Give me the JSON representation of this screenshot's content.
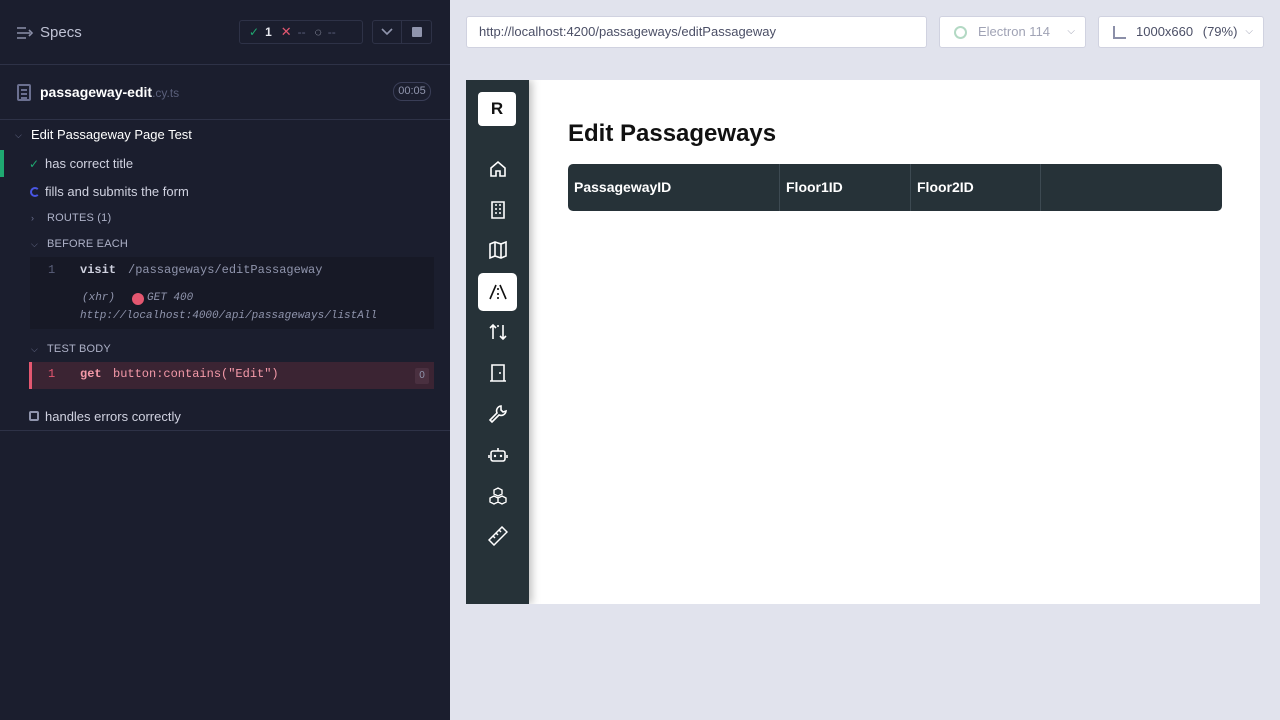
{
  "reporter": {
    "specs_label": "Specs",
    "stats": {
      "passed": "1",
      "failed": "--",
      "pending": "--"
    },
    "file": {
      "name": "passageway-edit",
      "ext": ".cy.ts",
      "duration": "00:05"
    },
    "suite_title": "Edit Passageway Page Test",
    "tests": [
      {
        "label": "has correct title",
        "state": "passed"
      },
      {
        "label": "fills and submits the form",
        "state": "running"
      },
      {
        "label": "handles errors correctly",
        "state": "pending"
      }
    ],
    "routes_label": "ROUTES (1)",
    "before_each_label": "BEFORE EACH",
    "before_each_cmd": {
      "num": "1",
      "name": "visit",
      "arg": "/passageways/editPassageway"
    },
    "xhr": {
      "label": "(xhr)",
      "status": "GET 400",
      "url": "http://localhost:4000/api/passageways/listAll"
    },
    "test_body_label": "TEST BODY",
    "test_body_cmd": {
      "num": "1",
      "name": "get",
      "arg": "button:contains(\"Edit\")",
      "count": "0"
    }
  },
  "browser_bar": {
    "url": "http://localhost:4200/passageways/editPassageway",
    "browser": "Electron 114",
    "viewport": "1000x660",
    "zoom": "(79%)"
  },
  "app": {
    "logo": "R",
    "nav_icons": [
      "home-icon",
      "building-icon",
      "map-icon",
      "passageway-icon",
      "elevator-icon",
      "door-icon",
      "wrench-icon",
      "robot-icon",
      "cubes-icon",
      "ruler-icon"
    ],
    "active_nav": "passageway-icon",
    "page_title": "Edit Passageways",
    "table_headers": [
      "PassagewayID",
      "Floor1ID",
      "Floor2ID",
      ""
    ]
  },
  "colors": {
    "reporter_bg": "#1b1e2e",
    "pass": "#1fa971",
    "fail": "#e45770",
    "running": "#4956e3",
    "app_sidebar": "#263238"
  }
}
